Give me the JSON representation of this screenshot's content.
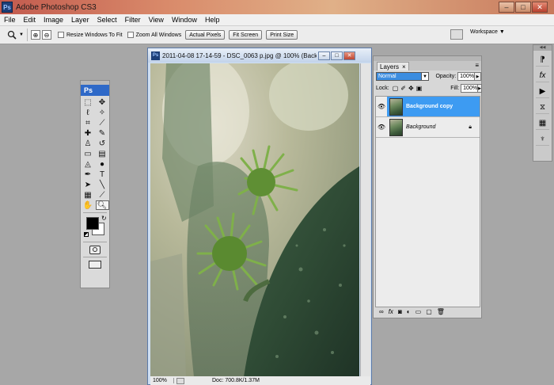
{
  "app": {
    "title": "Adobe Photoshop CS3",
    "logo": "Ps"
  },
  "window_controls": [
    "–",
    "□",
    "✕"
  ],
  "menu": [
    "File",
    "Edit",
    "Image",
    "Layer",
    "Select",
    "Filter",
    "View",
    "Window",
    "Help"
  ],
  "options_bar": {
    "tool_icon": "zoom-tool-icon",
    "resize_label": "Resize Windows To Fit",
    "zoom_all_label": "Zoom All Windows",
    "actual_pixels": "Actual Pixels",
    "fit_screen": "Fit Screen",
    "print_size": "Print Size",
    "workspace": "Workspace ▼"
  },
  "toolbox": {
    "logo": "Ps"
  },
  "document": {
    "title": "2011-04-08 17-14-59 - DSC_0063 p.jpg @ 100% (Back...",
    "icon": "Ps",
    "zoom": "100%",
    "doc_size": "Doc: 700.8K/1.37M"
  },
  "layers_panel": {
    "tab_label": "Layers",
    "blend_mode": "Normal",
    "opacity_label": "Opacity:",
    "opacity_value": "100%",
    "lock_label": "Lock:",
    "fill_label": "Fill:",
    "fill_value": "100%",
    "layers": [
      {
        "name": "Background copy",
        "selected": true,
        "locked": false
      },
      {
        "name": "Background",
        "selected": false,
        "locked": true
      }
    ]
  },
  "colors": {
    "accent": "#3d9bf2",
    "foreground": "#000000",
    "background": "#ffffff",
    "title_bar": "#c25a4e"
  }
}
